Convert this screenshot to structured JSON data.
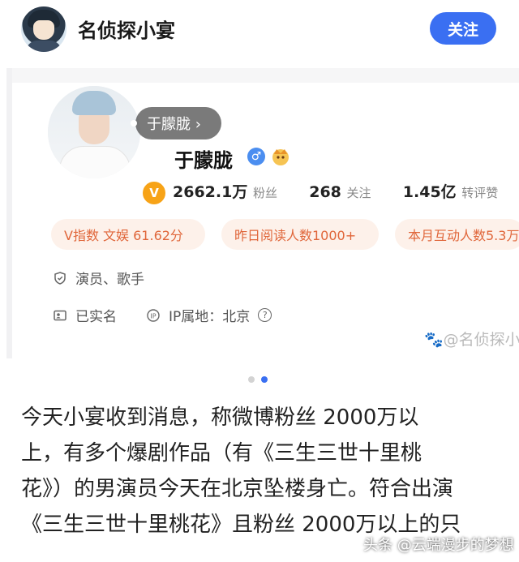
{
  "header": {
    "author_name": "名侦探小宴",
    "follow_label": "关注"
  },
  "profile": {
    "name_pill": "于朦胧 ›",
    "username": "于朦胧",
    "verified_badge": "V",
    "gender_symbol": "♂",
    "stats": [
      {
        "value": "2662.1万",
        "unit": "粉丝"
      },
      {
        "value": "268",
        "unit": "关注"
      },
      {
        "value": "1.45亿",
        "unit": "转评赞"
      }
    ],
    "tags": [
      "V指数 文娱 61.62分",
      "昨日阅读人数1000+",
      "本月互动人数5.3万"
    ],
    "occupation": "演员、歌手",
    "real_name": "已实名",
    "ip_label": "IP属地：北京",
    "ip_help": "?",
    "watermark": "@名侦探小"
  },
  "pager": {
    "active_index": 1,
    "count": 2
  },
  "article": {
    "lines": [
      "今天小宴收到消息，称微博粉丝 2000万以",
      "上，有多个爆剧作品（有《三生三世十里桃",
      "花》）的男演员今天在北京坠楼身亡。符合出演",
      "《三生三世十里桃花》且粉丝 2000万以上的只"
    ]
  },
  "bottom_watermark": "头条 @云端漫步的梦想",
  "colors": {
    "accent": "#3a6ff2",
    "tag_text": "#e0663a",
    "tag_bg": "#fdf1ea"
  }
}
